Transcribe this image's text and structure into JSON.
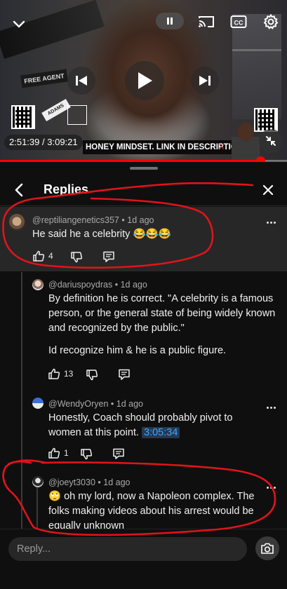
{
  "player": {
    "time_current": "2:51:39",
    "time_total": "3:09:21",
    "time_separator": "/",
    "progress_fraction": 0.907,
    "banner_text": "HONEY MINDSET. LINK IN DESCRIPTION",
    "sign_text": "FREE AGENT",
    "sign2_text": "ADAMS",
    "cc_label": "CC",
    "icons": [
      "chevron-down-icon",
      "pause-icon",
      "cast-icon",
      "cc-icon",
      "gear-icon",
      "skip-previous-icon",
      "play-icon",
      "skip-next-icon",
      "fullscreen-exit-icon"
    ]
  },
  "panel": {
    "title": "Replies",
    "icons": [
      "chevron-left-icon",
      "close-icon"
    ]
  },
  "parent_comment": {
    "author": "@reptiliangenetics357",
    "age": "1d ago",
    "separator": "•",
    "text": "He said he a celebrity 😂😂😂",
    "likes": "4"
  },
  "replies": [
    {
      "author": "@dariuspoydras",
      "age": "1d ago",
      "separator": "•",
      "paragraph1": "By definition he is correct. \"A celebrity is a famous person, or the general state of being widely known and recognized by the public.\"",
      "paragraph2": "Id recognize him & he is a public figure.",
      "likes": "13"
    },
    {
      "author": "@WendyOryen",
      "age": "1d ago",
      "separator": "•",
      "text": "Honestly, Coach should probably pivot to women at this point.",
      "timestamp": "3:05:34",
      "likes": "1"
    },
    {
      "author": "@joeyt3030",
      "age": "1d ago",
      "separator": "•",
      "emoji": "🙄",
      "text": "oh my lord, now a Napoleon complex. The folks making videos about his arrest would be equally unknown"
    }
  ],
  "composer": {
    "placeholder": "Reply...",
    "icon": "camera-icon"
  },
  "colors": {
    "background": "#0f0f0f",
    "highlight": "#272727",
    "progress": "#ff0000",
    "annotation": "#e0141b",
    "link": "#3ea6ff"
  }
}
